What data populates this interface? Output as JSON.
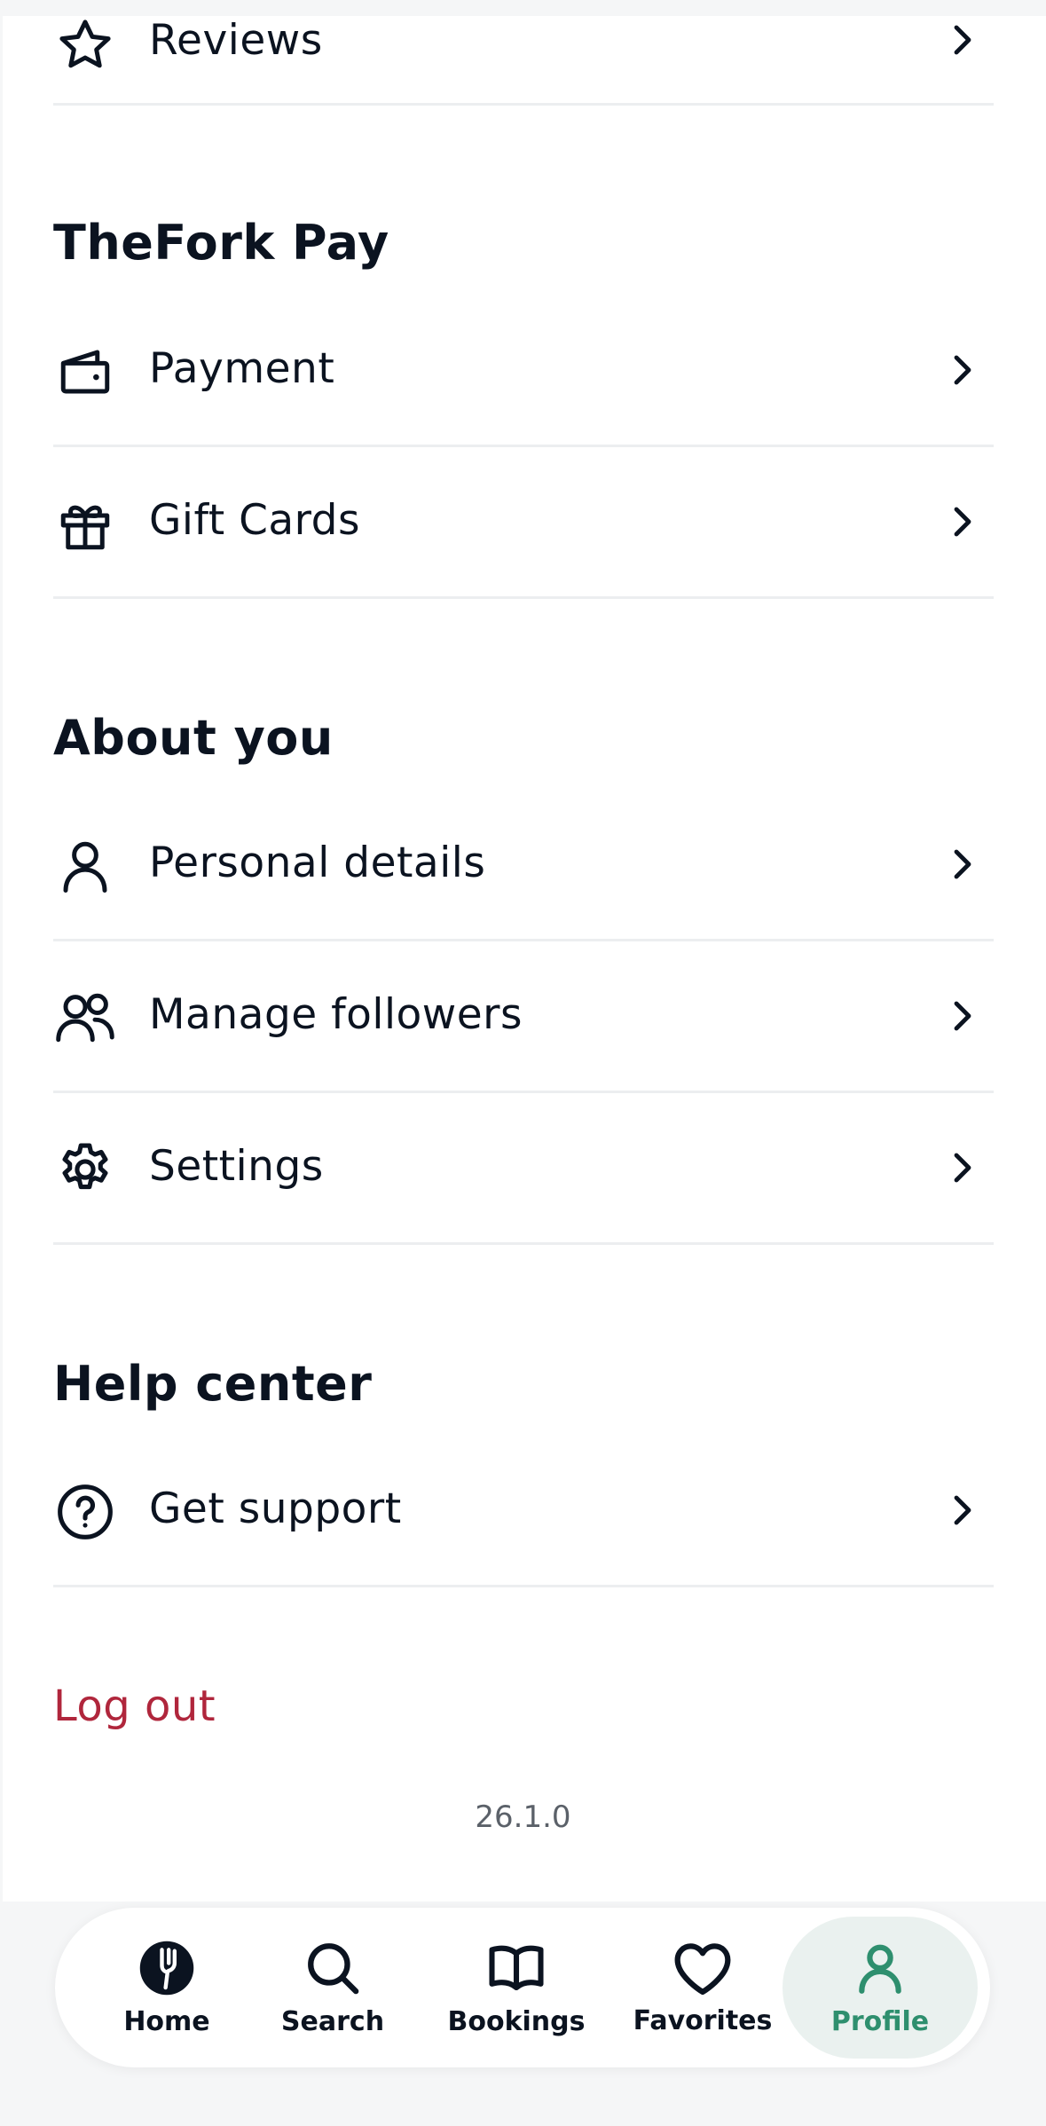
{
  "sections": {
    "reviews_label": "Reviews",
    "thefork_pay": {
      "title": "TheFork Pay",
      "items": [
        {
          "label": "Payment",
          "icon": "wallet-icon"
        },
        {
          "label": "Gift Cards",
          "icon": "gift-icon"
        }
      ]
    },
    "about_you": {
      "title": "About you",
      "items": [
        {
          "label": "Personal details",
          "icon": "person-icon"
        },
        {
          "label": "Manage followers",
          "icon": "people-icon"
        },
        {
          "label": "Settings",
          "icon": "gear-icon"
        }
      ]
    },
    "help_center": {
      "title": "Help center",
      "items": [
        {
          "label": "Get support",
          "icon": "help-circle-icon"
        }
      ]
    }
  },
  "logout_label": "Log out",
  "version": "26.1.0",
  "tabbar": {
    "active": "Profile",
    "accent_color": "#2e8f6e",
    "tabs": [
      {
        "label": "Home",
        "icon": "fork-icon"
      },
      {
        "label": "Search",
        "icon": "search-icon"
      },
      {
        "label": "Bookings",
        "icon": "book-icon"
      },
      {
        "label": "Favorites",
        "icon": "heart-icon"
      },
      {
        "label": "Profile",
        "icon": "person-icon"
      }
    ]
  }
}
